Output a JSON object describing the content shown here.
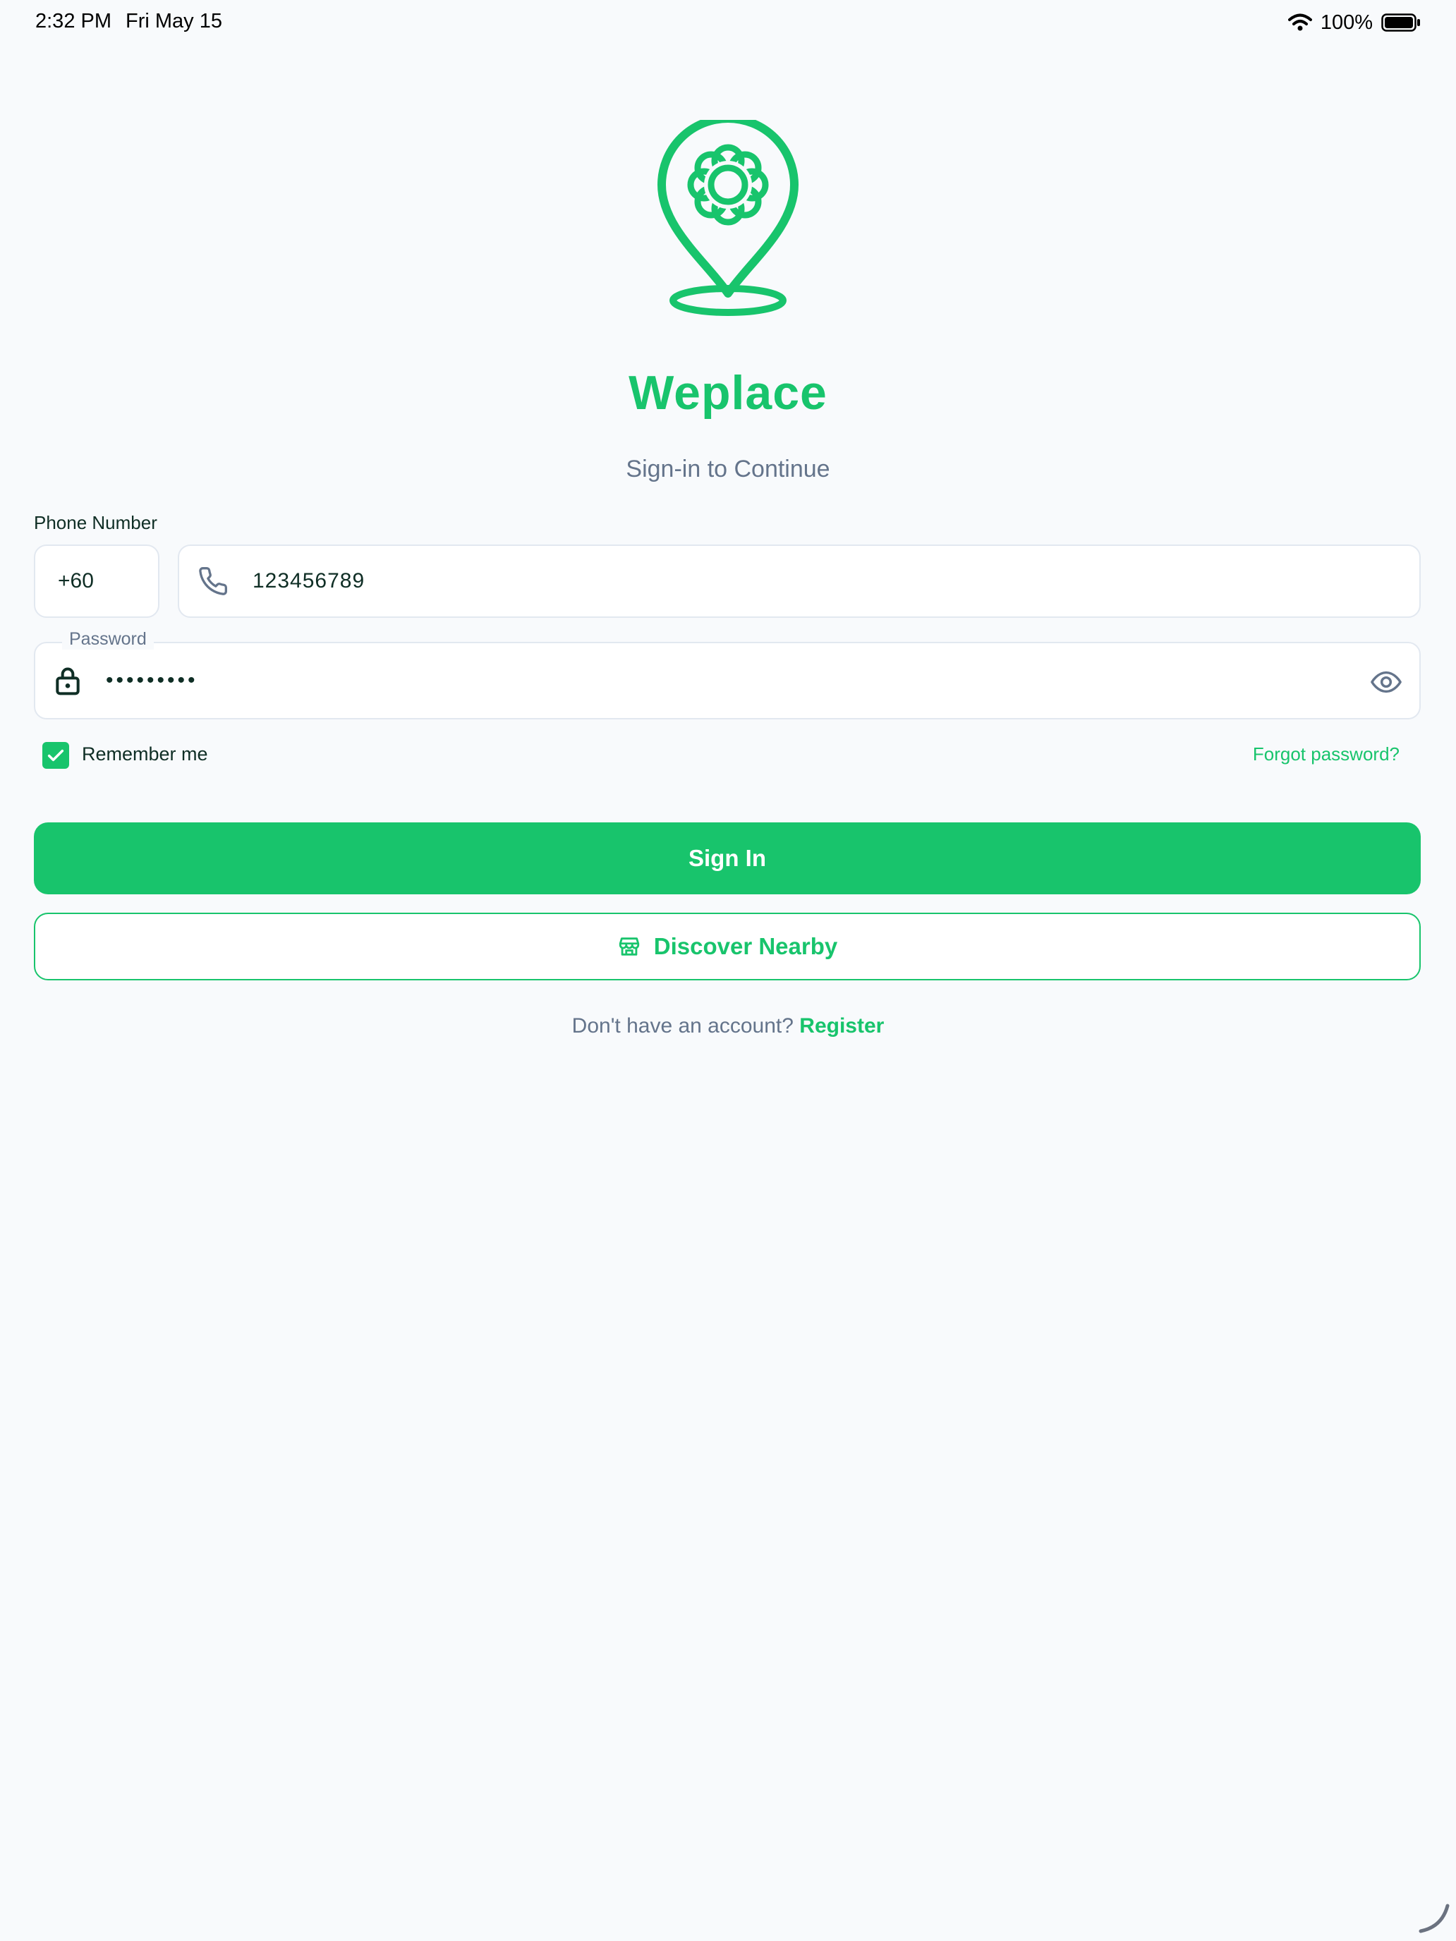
{
  "status_bar": {
    "time": "2:32 PM",
    "date": "Fri May 15",
    "battery": "100%",
    "icons": [
      "wifi-icon",
      "battery-icon"
    ]
  },
  "app": {
    "logo_icon": "flower-location-pin-icon",
    "title": "Weplace",
    "subtitle": "Sign-in to Continue"
  },
  "form": {
    "phone_label": "Phone Number",
    "country_code": "+60",
    "phone_icon": "phone-icon",
    "phone_value": "123456789",
    "password_label": "Password",
    "password_icon": "lock-icon",
    "password_value": "•••••••••",
    "visibility_icon": "eye-icon",
    "remember_label": "Remember me",
    "remember_checked": true,
    "forgot_label": "Forgot password?"
  },
  "actions": {
    "sign_in_label": "Sign In",
    "discover_icon": "store-icon",
    "discover_label": "Discover Nearby",
    "no_account_text": "Don't have an account?",
    "register_label": "Register"
  },
  "colors": {
    "accent": "#18c46c",
    "background": "#f8fafc",
    "text": "#0f2e25",
    "muted": "#64748b",
    "border": "#e2e8f0"
  }
}
